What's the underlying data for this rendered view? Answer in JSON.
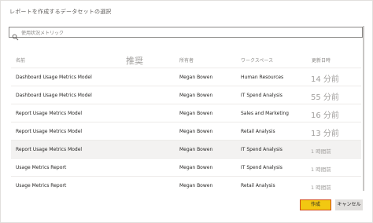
{
  "dialog": {
    "title": "レポートを作成するデータセットの選択"
  },
  "search": {
    "placeholder": "使用状況メトリック",
    "icon": "search-icon"
  },
  "columns": {
    "name": "名前",
    "recommend": "推奨",
    "owner": "所有者",
    "workspace": "ワークスペース",
    "updated": "更新日時"
  },
  "rows": [
    {
      "name": "Dashboard Usage Metrics Model",
      "owner": "Megan Bowen",
      "workspace": "Human Resources",
      "updated": "14 分前",
      "selected": false
    },
    {
      "name": "Dashboard Usage Metrics Model",
      "owner": "Megan Bowen",
      "workspace": "IT Spend Analysis",
      "updated": "55 分前",
      "selected": false
    },
    {
      "name": "Report Usage Metrics Model",
      "owner": "Megan Bowen",
      "workspace": "Sales and Marketing",
      "updated": "16 分前",
      "selected": false
    },
    {
      "name": "Report Usage Metrics Model",
      "owner": "Megan Bowen",
      "workspace": "Retail Analysis",
      "updated": "13 分前",
      "selected": false
    },
    {
      "name": "Report Usage Metrics Model",
      "owner": "Megan Bowen",
      "workspace": "IT Spend Analysis",
      "updated": "1 時間前",
      "selected": true
    },
    {
      "name": "Usage Metrics Report",
      "owner": "Megan Bowen",
      "workspace": "IT Spend Analysis",
      "updated": "1 時間前",
      "selected": false
    },
    {
      "name": "Usage Metrics Report",
      "owner": "Megan Bowen",
      "workspace": "Retail Analysis",
      "updated": "1 時間前",
      "selected": false
    }
  ],
  "buttons": {
    "create": "作成",
    "cancel": "キャンセル"
  },
  "colors": {
    "accent": "#f2c811",
    "accent_border": "#d14a1a",
    "selected_row": "#f3f2f1"
  }
}
